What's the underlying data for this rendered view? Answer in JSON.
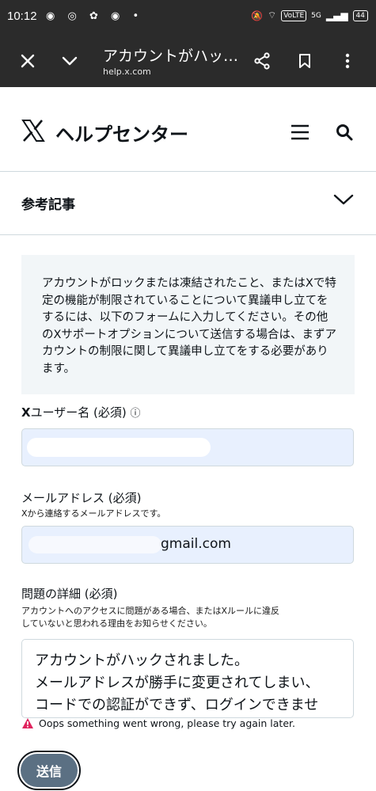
{
  "status_bar": {
    "time": "10:12",
    "notif_glyphs": "◉ ◎ ✿ ◉ •",
    "volte": "VoLTE",
    "network": "5G",
    "battery": "44"
  },
  "browser": {
    "title": "アカウントがハッ…",
    "url": "help.x.com"
  },
  "header": {
    "logo_letter": "X",
    "brand": "ヘルプセンター"
  },
  "reference": {
    "label": "参考記事"
  },
  "notice": {
    "text": "アカウントがロックまたは凍結されたこと、またはXで特定の機能が制限されていることについて異議申し立てをするには、以下のフォームに入力してください。その他のXサポートオプションについて送信する場合は、まずアカウントの制限に関して異議申し立てをする必要があります。"
  },
  "form": {
    "username_label_bold": "X",
    "username_label_rest": "ユーザー名 (必須)",
    "username_info": "ⓘ",
    "email_label": "メールアドレス (必須)",
    "email_hint": "Xから連絡するメールアドレスです。",
    "email_value": "gmail.com",
    "detail_label": "問題の詳細 (必須)",
    "detail_hint_1": "アカウントへのアクセスに問題がある場合、またはXルールに違反",
    "detail_hint_2": "していないと思われる理由をお知らせください。",
    "detail_line_1": "アカウントがハックされました。",
    "detail_line_2": "メールアドレスが勝手に変更されてしまい、",
    "detail_line_3": "コードでの認証ができず、ログインできませ",
    "error": "Oops something went wrong, please try again later.",
    "submit": "送信"
  },
  "colors": {
    "toolbar": "#2b2b2b",
    "input_fill": "#e8f0fe",
    "submit_fill": "#5b7083",
    "error_icon": "#e0245e"
  }
}
